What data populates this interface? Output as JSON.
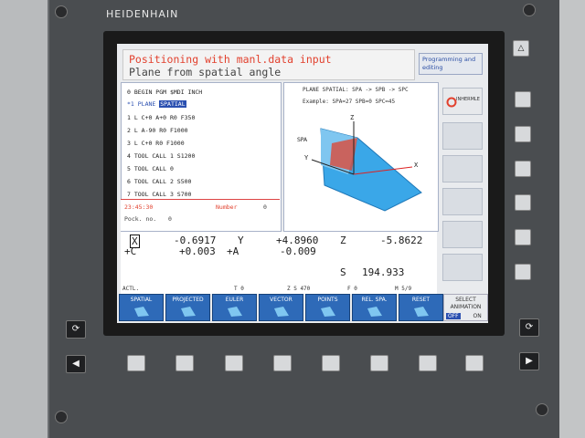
{
  "brand": "HEIDENHAIN",
  "header": {
    "line1": "Positioning with manl.data input",
    "line2": "Plane from spatial angle",
    "mode": "Programming and editing"
  },
  "program": {
    "lines": [
      "0  BEGIN PGM $MDI INCH",
      "*1  PLANE",
      "1  L  C+0  A+0 R0 F350",
      "2  L  A-90 R0 F1000",
      "3  L  C+0 R0 F1000",
      "4  TOOL CALL 1 S1200",
      "5  TOOL CALL 0",
      "6  TOOL CALL 2 S500",
      "7  TOOL CALL 3 S700"
    ],
    "selected_highlight": "SPATIAL"
  },
  "status": {
    "time": "23:45:30",
    "number_label": "Number",
    "number_value": "0",
    "pock_label": "Pock. no.",
    "pock_value": "0"
  },
  "help": {
    "title": "PLANE SPATIAL: SPA -> SPB -> SPC",
    "example": "Example: SPA=27 SPB=0 SPC=45",
    "axis_labels": [
      "Z",
      "X",
      "Y"
    ],
    "spa_label": "SPA"
  },
  "side": {
    "tnc_label": "INHERMLE"
  },
  "positions": {
    "x_label": "X",
    "x_value": "-0.6917",
    "y_label": "Y",
    "y_value": "+4.8960",
    "z_label": "Z",
    "z_value": "-5.8622",
    "c_label": "+C",
    "c_value": "+0.003",
    "a_label": "+A",
    "a_value": "-0.009",
    "s_label": "S",
    "s_value": "194.933"
  },
  "actl_bar": {
    "actl": "ACTL.",
    "t": "T 0",
    "z": "Z S 470",
    "f": "F 0",
    "m": "M 5/9"
  },
  "softkeys": [
    {
      "label": "SPATIAL"
    },
    {
      "label": "PROJECTED"
    },
    {
      "label": "EULER"
    },
    {
      "label": "VECTOR"
    },
    {
      "label": "POINTS"
    },
    {
      "label": "REL. SPA."
    },
    {
      "label": "RESET"
    }
  ],
  "select_animation": {
    "label_line1": "SELECT",
    "label_line2": "ANIMATION",
    "off": "OFF",
    "on": "ON"
  },
  "colors": {
    "screen_bg": "#e9ebee",
    "header_red": "#e2412e",
    "softkey_blue": "#2e6ab8",
    "shape_blue": "#3aa7e8"
  }
}
